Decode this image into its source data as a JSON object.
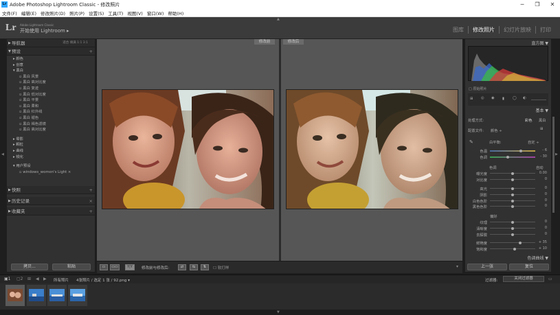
{
  "window": {
    "title": "Adobe Photoshop Lightroom Classic - 修改照片",
    "app_icon": "Lr",
    "minimize": "─",
    "maximize": "❐",
    "close": "✕"
  },
  "menu": [
    "文件(F)",
    "编辑(E)",
    "修改照片(D)",
    "照片(P)",
    "设置(S)",
    "工具(T)",
    "视图(V)",
    "窗口(W)",
    "帮助(H)"
  ],
  "identity": {
    "logo": "Lr",
    "brand_small": "Adobe Lightroom Classic",
    "brand_main": "开始使用 Lightroom ▸"
  },
  "modules": [
    "图库",
    "修改照片",
    "幻灯片放映",
    "打印"
  ],
  "active_module": "修改照片",
  "left_panel": {
    "navigator": {
      "title": "导航器",
      "tags": "适合  填满  1:1  3:1"
    },
    "presets": {
      "title": "预设",
      "plus": "+"
    },
    "preset_rows": [
      {
        "label": "▸ 颜色",
        "type": "fold"
      },
      {
        "label": "▸ 创意",
        "type": "fold"
      },
      {
        "label": "▾ 黑白",
        "type": "fold"
      },
      {
        "label": "▫ 黑白 风景",
        "type": "sub"
      },
      {
        "label": "▫ 黑白 高对比度",
        "type": "sub"
      },
      {
        "label": "▫ 黑白 复迹",
        "type": "sub"
      },
      {
        "label": "▫ 黑白 低对比度",
        "type": "sub"
      },
      {
        "label": "▫ 黑白 平景",
        "type": "sub"
      },
      {
        "label": "▫ 黑白 柔和",
        "type": "sub"
      },
      {
        "label": "▫ 黑白 红外线",
        "type": "sub"
      },
      {
        "label": "▫ 黑白 褪色",
        "type": "sub"
      },
      {
        "label": "▫ 黑白 褐色滤镜",
        "type": "sub"
      },
      {
        "label": "▫ 黑白 高对比度",
        "type": "sub"
      },
      {
        "label": "",
        "type": "gap"
      },
      {
        "label": "▸ 晕影",
        "type": "fold"
      },
      {
        "label": "▸ 颗粒",
        "type": "fold"
      },
      {
        "label": "▸ 曲线",
        "type": "fold"
      },
      {
        "label": "▸ 锐化",
        "type": "fold"
      },
      {
        "label": "",
        "type": "gap"
      },
      {
        "label": "▾ 用户预设",
        "type": "fold"
      },
      {
        "label": "▫ windows_women's Light ×",
        "type": "sub"
      }
    ],
    "snapshots": {
      "title": "快照",
      "plus": "+"
    },
    "history": {
      "title": "历史记录",
      "x": "×"
    },
    "collections": {
      "title": "收藏夹",
      "plus": "+"
    },
    "copy_button": "拷贝...",
    "paste_button": "粘贴"
  },
  "view": {
    "before_label": "修改前",
    "after_label": "修改后"
  },
  "toolbar": {
    "mode": "Y|Y",
    "label": "修改前与修改后:",
    "softproof": "软打样"
  },
  "right_panel": {
    "histogram_title": "直方图",
    "original_photo": "□ 原始照片",
    "basic_title": "基本",
    "treatment_label": "处理方式:",
    "treatment_color": "彩色",
    "treatment_bw": "黑白",
    "profile_label": "配置文件:",
    "profile_value": "颜色 ÷",
    "wb_label": "白平衡:",
    "wb_value": "自定 ÷",
    "temp_label": "色温",
    "temp_value": "- 6",
    "tint_label": "色调",
    "tint_value": "- 30",
    "tone_label": "色调",
    "auto_label": "自动",
    "exposure_label": "曝光度",
    "exposure_value": "0.00",
    "contrast_label": "对比度",
    "contrast_value": "0",
    "highlights_label": "高光",
    "highlights_value": "0",
    "shadows_label": "阴影",
    "shadows_value": "0",
    "whites_label": "白色色阶",
    "whites_value": "0",
    "blacks_label": "黑色色阶",
    "blacks_value": "0",
    "presence_label": "偏好",
    "texture_label": "纹理",
    "texture_value": "0",
    "clarity_label": "清晰度",
    "clarity_value": "0",
    "dehaze_label": "去朦胧",
    "dehaze_value": "0",
    "vibrance_label": "鲜艳度",
    "vibrance_value": "+ 35",
    "saturation_label": "饱和度",
    "saturation_value": "+ 10",
    "tone_curve_title": "色调曲线",
    "prev_button": "上一张",
    "reset_button": "复位"
  },
  "filmbar": {
    "page1": "1",
    "page2": "2",
    "source": "所有照片",
    "count": "4张照片 / 选定 1 张 / 92.png ▾",
    "filter_label": "过滤器:",
    "filter_value": "关闭过滤器"
  },
  "colors": {
    "accent": "#eeeeee",
    "panel": "#313131",
    "bg": "#565656"
  }
}
